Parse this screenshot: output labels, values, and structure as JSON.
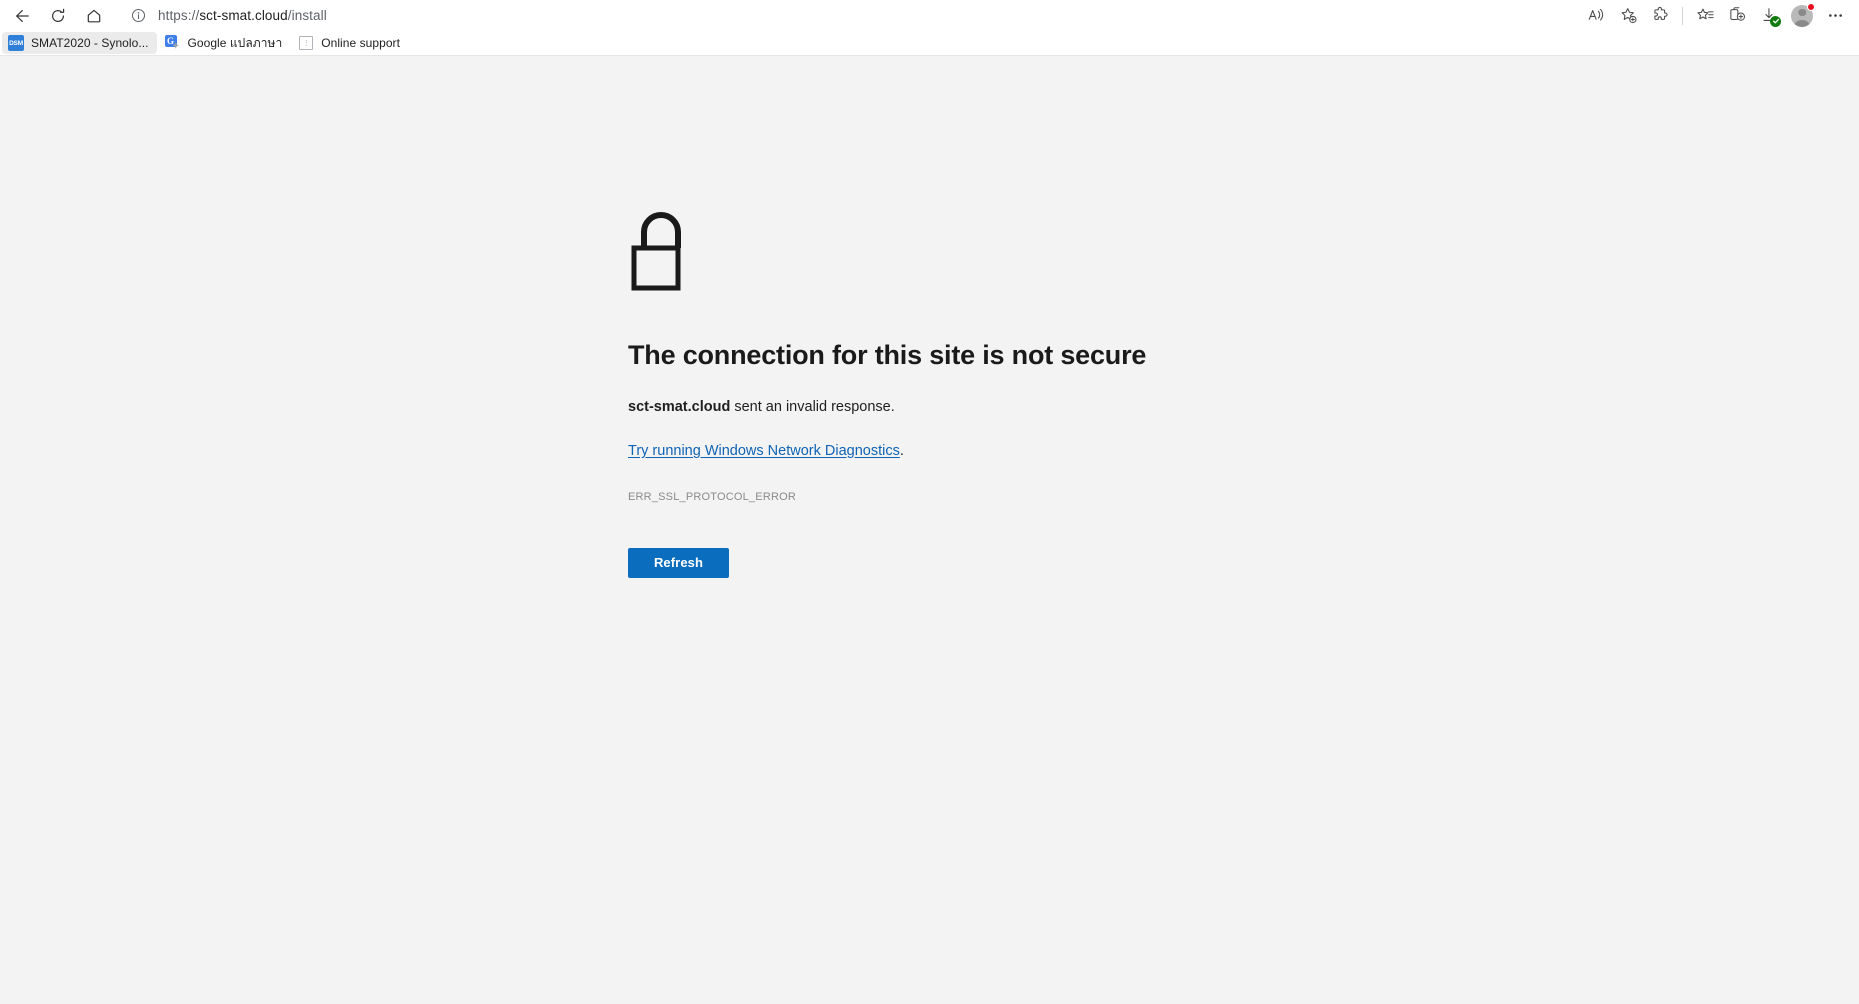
{
  "browser": {
    "nav": {
      "back_label": "Back",
      "refresh_label": "Refresh",
      "home_label": "Home"
    },
    "address_bar": {
      "scheme": "https://",
      "host": "sct-smat.cloud",
      "path": "/install",
      "full_url": "https://sct-smat.cloud/install",
      "site_info_icon": "info-circle-icon"
    },
    "toolbar_icons": [
      {
        "name": "read-aloud-icon",
        "label": "Read aloud"
      },
      {
        "name": "add-favorite-icon",
        "label": "Add this page to favorites"
      },
      {
        "name": "extensions-icon",
        "label": "Extensions"
      },
      {
        "name": "collections-icon",
        "label": "Collections"
      },
      {
        "name": "split-screen-icon",
        "label": "Split screen"
      },
      {
        "name": "downloads-icon",
        "label": "Downloads"
      },
      {
        "name": "profile-icon",
        "label": "Profile"
      },
      {
        "name": "settings-more-icon",
        "label": "Settings and more"
      }
    ],
    "bookmarks": [
      {
        "icon": "dsm-icon",
        "icon_text": "DSM",
        "label": "SMAT2020 - Synolo..."
      },
      {
        "icon": "google-translate-icon",
        "icon_text": "G",
        "label": "Google แปลภาษา"
      },
      {
        "icon": "document-icon",
        "icon_text": "",
        "label": "Online support"
      }
    ]
  },
  "error_page": {
    "icon": "unlocked-padlock-icon",
    "title": "The connection for this site is not secure",
    "description_host": "sct-smat.cloud",
    "description_rest": " sent an invalid response.",
    "link_text": "Try running Windows Network Diagnostics",
    "link_suffix": ".",
    "error_code": "ERR_SSL_PROTOCOL_ERROR",
    "refresh_button": "Refresh"
  },
  "colors": {
    "accent_blue": "#0b6dbd",
    "link_blue": "#0f63b5",
    "page_background": "#f3f3f3",
    "chrome_background": "#ffffff",
    "download_badge_green": "#0f7b0f",
    "notification_red": "#e81123"
  }
}
